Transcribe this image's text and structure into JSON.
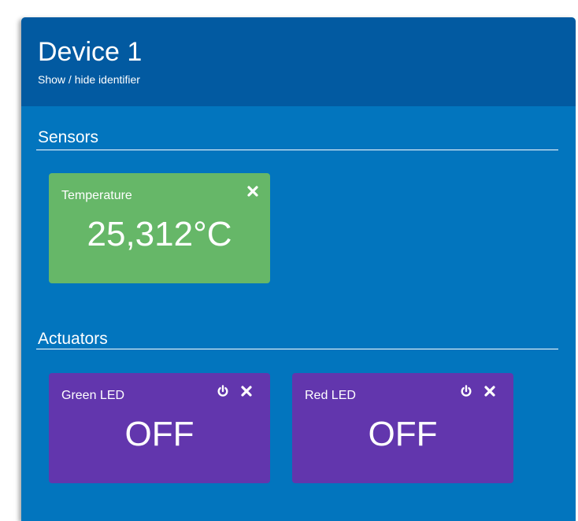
{
  "device": {
    "title": "Device 1",
    "toggle_identifier_label": "Show / hide identifier"
  },
  "sections": {
    "sensors_title": "Sensors",
    "actuators_title": "Actuators"
  },
  "sensors": [
    {
      "label": "Temperature",
      "value": "25,312°C",
      "remove_icon": "close-icon"
    }
  ],
  "actuators": [
    {
      "label": "Green LED",
      "state": "OFF",
      "power_icon": "power-icon",
      "remove_icon": "close-icon"
    },
    {
      "label": "Red LED",
      "state": "OFF",
      "power_icon": "power-icon",
      "remove_icon": "close-icon"
    }
  ],
  "colors": {
    "header": "#025aa1",
    "body": "#0275be",
    "sensor_tile": "#66b768",
    "actuator_tile": "#6236ad"
  }
}
